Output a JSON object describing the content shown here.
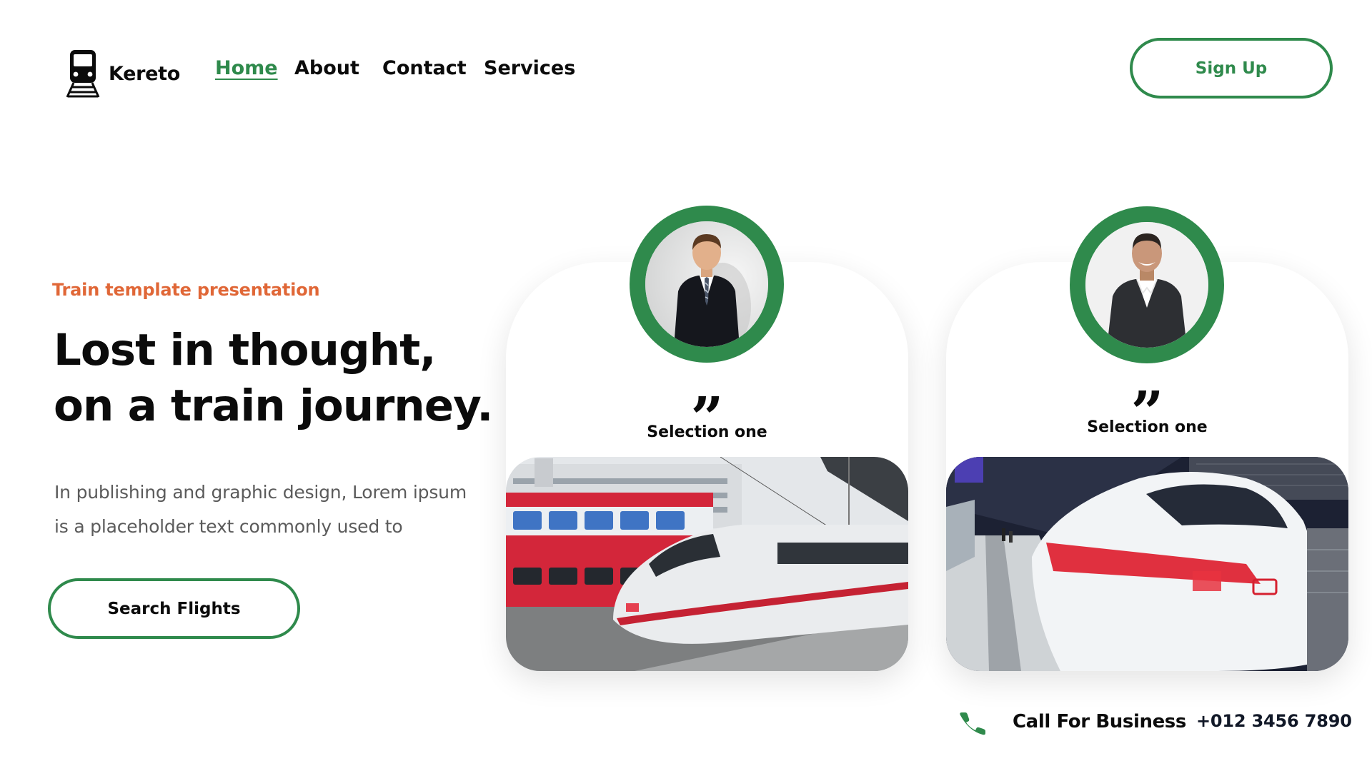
{
  "brand": {
    "name": "Kereto",
    "icon": "train-icon"
  },
  "nav": {
    "items": [
      "Home",
      "About",
      "Contact",
      "Services"
    ],
    "active": "Home"
  },
  "header": {
    "signup_label": "Sign Up"
  },
  "hero": {
    "eyebrow": "Train template presentation",
    "headline_line1": "Lost in thought,",
    "headline_line2": "on a train journey.",
    "description_line1": "In publishing and graphic design, Lorem ipsum",
    "description_line2": "is a placeholder text commonly used to",
    "cta_label": "Search Flights"
  },
  "cards": [
    {
      "quote": "”",
      "title": "Selection one",
      "avatar": "man-in-suit-and-tie",
      "photo": "ice-train-at-outdoor-platform"
    },
    {
      "quote": "”",
      "title": "Selection one",
      "avatar": "smiling-man-in-blazer",
      "photo": "ice-train-at-indoor-station"
    }
  ],
  "contact": {
    "label": "Call For Business",
    "phone": "+012 3456 7890",
    "icon": "phone-icon"
  },
  "colors": {
    "accent_green": "#2f8a4c",
    "accent_orange": "#e06737",
    "text_dark": "#0b0b0b",
    "text_muted": "#5b5b5b"
  }
}
